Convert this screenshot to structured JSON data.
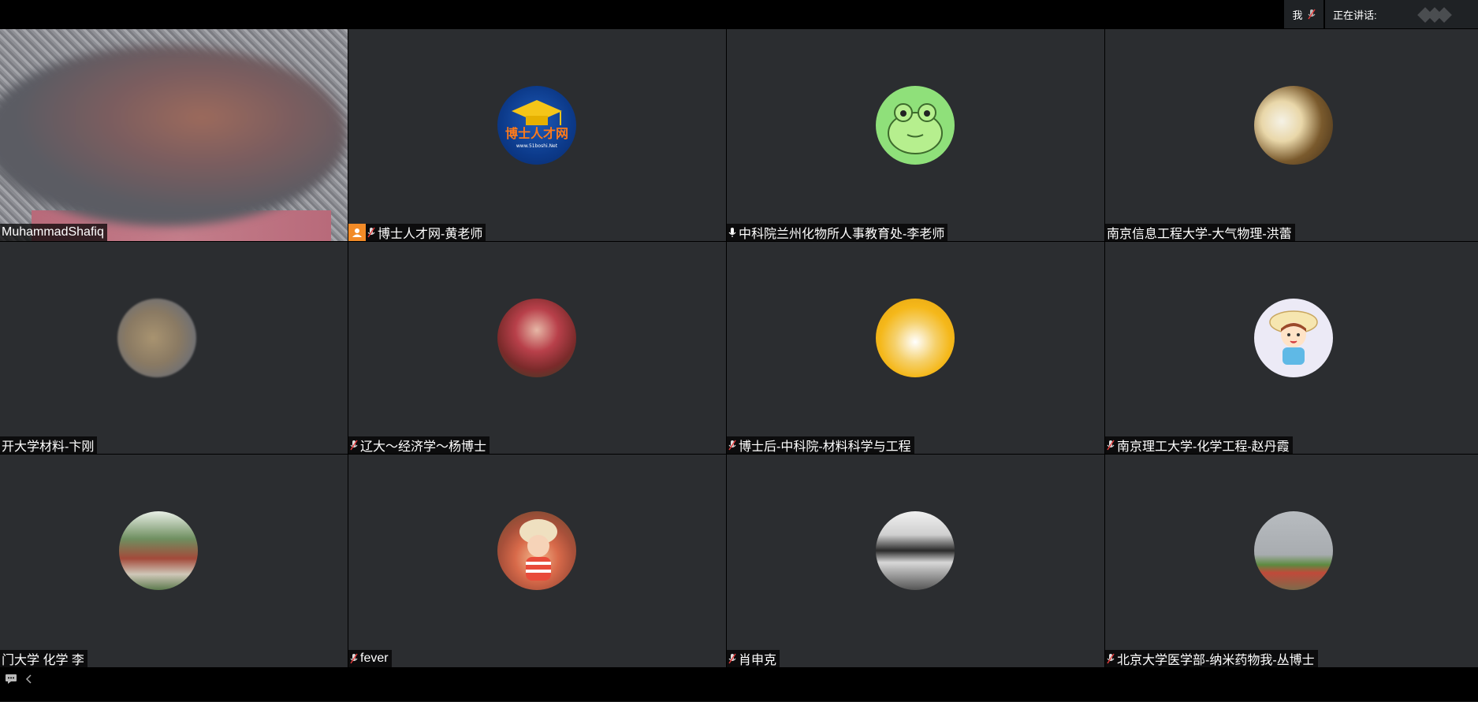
{
  "topbar": {
    "me_label": "我",
    "speaking_label": "正在讲话:"
  },
  "participants": [
    {
      "name": "MuhammadShafiq",
      "mic": "none",
      "video": true
    },
    {
      "name": "博士人才网-黄老师",
      "mic": "muted",
      "host": true
    },
    {
      "name": "中科院兰州化物所人事教育处-李老师",
      "mic": "on"
    },
    {
      "name": "南京信息工程大学-大气物理-洪蕾",
      "mic": "none"
    },
    {
      "name": "开大学材料-卞刚",
      "mic": "none"
    },
    {
      "name": "辽大～经济学～杨博士",
      "mic": "muted"
    },
    {
      "name": "博士后-中科院-材料科学与工程",
      "mic": "muted"
    },
    {
      "name": "南京理工大学-化学工程-赵丹霞",
      "mic": "muted"
    },
    {
      "name": "门大学 化学 李",
      "mic": "none"
    },
    {
      "name": "fever",
      "mic": "muted"
    },
    {
      "name": "肖申克",
      "mic": "muted"
    },
    {
      "name": "北京大学医学部-纳米药物我-丛博士",
      "mic": "muted"
    }
  ],
  "avatars": {
    "avatar1_text": "博士人才网",
    "avatar1_sub": "www.51boshi.Net"
  },
  "colors": {
    "tile_bg": "#2b2d30",
    "host_badge": "#f28b27",
    "muted_red": "#e33b3b"
  }
}
